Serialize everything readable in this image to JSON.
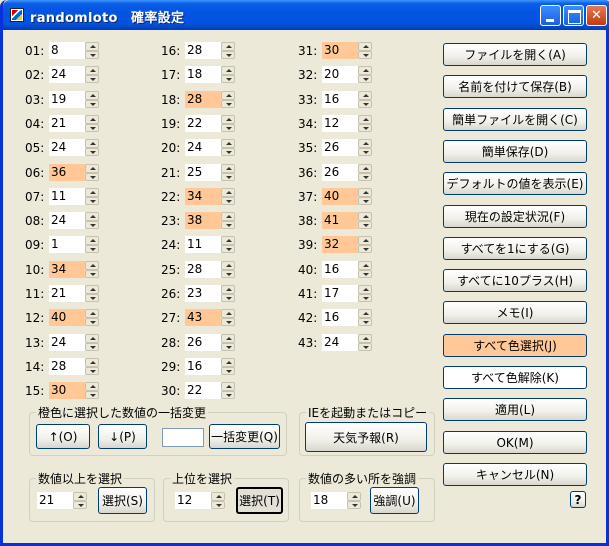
{
  "window": {
    "title": "randomloto　確率設定",
    "title_icon": "loto-app-icon",
    "minimize_icon": "minimize-icon",
    "maximize_icon": "maximize-icon",
    "close_icon": "close-icon"
  },
  "highlight_color": "#ffc896",
  "columns": [
    [
      {
        "label": "01:",
        "value": "8",
        "hl": false
      },
      {
        "label": "02:",
        "value": "24",
        "hl": false
      },
      {
        "label": "03:",
        "value": "19",
        "hl": false
      },
      {
        "label": "04:",
        "value": "21",
        "hl": false
      },
      {
        "label": "05:",
        "value": "24",
        "hl": false
      },
      {
        "label": "06:",
        "value": "36",
        "hl": true
      },
      {
        "label": "07:",
        "value": "11",
        "hl": false
      },
      {
        "label": "08:",
        "value": "24",
        "hl": false
      },
      {
        "label": "09:",
        "value": "1",
        "hl": false
      },
      {
        "label": "10:",
        "value": "34",
        "hl": true
      },
      {
        "label": "11:",
        "value": "21",
        "hl": false
      },
      {
        "label": "12:",
        "value": "40",
        "hl": true
      },
      {
        "label": "13:",
        "value": "24",
        "hl": false
      },
      {
        "label": "14:",
        "value": "28",
        "hl": false
      },
      {
        "label": "15:",
        "value": "30",
        "hl": true
      }
    ],
    [
      {
        "label": "16:",
        "value": "28",
        "hl": false
      },
      {
        "label": "17:",
        "value": "18",
        "hl": false
      },
      {
        "label": "18:",
        "value": "28",
        "hl": true
      },
      {
        "label": "19:",
        "value": "22",
        "hl": false
      },
      {
        "label": "20:",
        "value": "24",
        "hl": false
      },
      {
        "label": "21:",
        "value": "25",
        "hl": false
      },
      {
        "label": "22:",
        "value": "34",
        "hl": true
      },
      {
        "label": "23:",
        "value": "38",
        "hl": true
      },
      {
        "label": "24:",
        "value": "11",
        "hl": false
      },
      {
        "label": "25:",
        "value": "28",
        "hl": false
      },
      {
        "label": "26:",
        "value": "23",
        "hl": false
      },
      {
        "label": "27:",
        "value": "43",
        "hl": true
      },
      {
        "label": "28:",
        "value": "26",
        "hl": false
      },
      {
        "label": "29:",
        "value": "16",
        "hl": false
      },
      {
        "label": "30:",
        "value": "22",
        "hl": false
      }
    ],
    [
      {
        "label": "31:",
        "value": "30",
        "hl": true
      },
      {
        "label": "32:",
        "value": "20",
        "hl": false
      },
      {
        "label": "33:",
        "value": "16",
        "hl": false
      },
      {
        "label": "34:",
        "value": "12",
        "hl": false
      },
      {
        "label": "35:",
        "value": "26",
        "hl": false
      },
      {
        "label": "36:",
        "value": "26",
        "hl": false
      },
      {
        "label": "37:",
        "value": "40",
        "hl": true
      },
      {
        "label": "38:",
        "value": "41",
        "hl": true
      },
      {
        "label": "39:",
        "value": "32",
        "hl": true
      },
      {
        "label": "40:",
        "value": "16",
        "hl": false
      },
      {
        "label": "41:",
        "value": "17",
        "hl": false
      },
      {
        "label": "42:",
        "value": "16",
        "hl": false
      },
      {
        "label": "43:",
        "value": "24",
        "hl": false
      }
    ]
  ],
  "right_buttons": [
    {
      "name": "open-file-button",
      "label": "ファイルを開く(A)",
      "style": ""
    },
    {
      "name": "save-as-button",
      "label": "名前を付けて保存(B)",
      "style": ""
    },
    {
      "name": "open-simple-file-button",
      "label": "簡単ファイルを開く(C)",
      "style": ""
    },
    {
      "name": "simple-save-button",
      "label": "簡単保存(D)",
      "style": ""
    },
    {
      "name": "show-default-button",
      "label": "デフォルトの値を表示(E)",
      "style": ""
    },
    {
      "name": "current-settings-button",
      "label": "現在の設定状況(F)",
      "style": ""
    },
    {
      "name": "set-all-one-button",
      "label": "すべてを1にする(G)",
      "style": ""
    },
    {
      "name": "add-ten-all-button",
      "label": "すべてに10プラス(H)",
      "style": ""
    },
    {
      "name": "memo-button",
      "label": "メモ(I)",
      "style": ""
    },
    {
      "name": "select-all-color-button",
      "label": "すべて色選択(J)",
      "style": "orange"
    },
    {
      "name": "clear-all-color-button",
      "label": "すべて色解除(K)",
      "style": "white"
    },
    {
      "name": "apply-button",
      "label": "適用(L)",
      "style": ""
    },
    {
      "name": "ok-button",
      "label": "OK(M)",
      "style": ""
    },
    {
      "name": "cancel-button",
      "label": "キャンセル(N)",
      "style": ""
    }
  ],
  "help_label": "?",
  "bulk_group": {
    "legend": "橙色に選択した数値の一括変更",
    "up_label": "↑(O)",
    "down_label": "↓(P)",
    "value": "",
    "apply_label": "一括変更(Q)"
  },
  "ie_group": {
    "legend": "IEを起動またはコピー",
    "weather_label": "天気予報(R)"
  },
  "over_group": {
    "legend": "数値以上を選択",
    "value": "21",
    "select_label": "選択(S)"
  },
  "top_group": {
    "legend": "上位を選択",
    "value": "12",
    "select_label": "選択(T)"
  },
  "emph_group": {
    "legend": "数値の多い所を強調",
    "value": "18",
    "emph_label": "強調(U)"
  }
}
